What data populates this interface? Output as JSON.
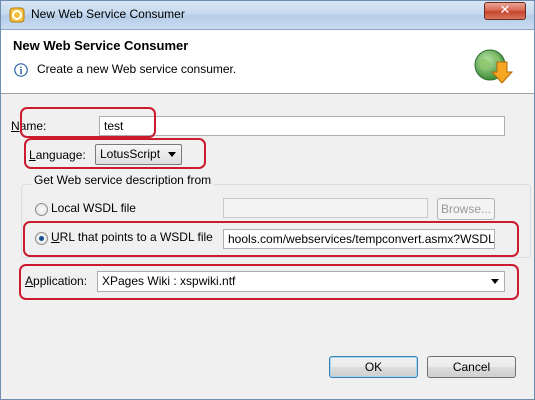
{
  "window": {
    "title": "New Web Service Consumer",
    "close_glyph": "✕"
  },
  "header": {
    "title": "New Web Service Consumer",
    "description": "Create a new Web service consumer.",
    "info_icon": "i"
  },
  "name": {
    "label_mnemonic": "N",
    "label_rest": "ame:",
    "value": "test"
  },
  "language": {
    "label_mnemonic": "L",
    "label_rest": "anguage:",
    "value": "LotusScript"
  },
  "wsdl_group": {
    "title": "Get Web service description from",
    "local": {
      "label": "Local WSDL file",
      "selected": false,
      "value": "",
      "browse_label": "Browse..."
    },
    "url": {
      "label_mnemonic": "U",
      "label_rest": "RL that points to a WSDL file",
      "selected": true,
      "value": "hools.com/webservices/tempconvert.asmx?WSDL"
    }
  },
  "application": {
    "label_mnemonic": "A",
    "label_rest": "pplication:",
    "value": "XPages Wiki : xspwiki.ntf"
  },
  "buttons": {
    "ok": "OK",
    "cancel": "Cancel"
  },
  "colors": {
    "highlight": "#cc1a2e",
    "accent": "#1a4f8e"
  }
}
